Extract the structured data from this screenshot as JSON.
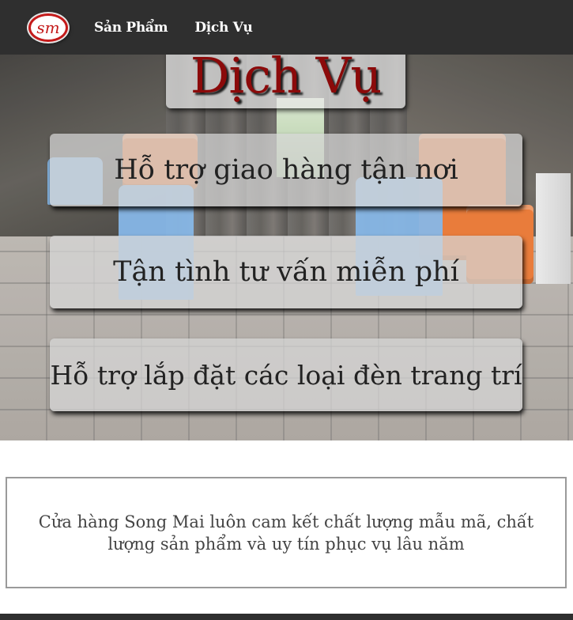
{
  "navbar": {
    "logo_text": "sm",
    "links": [
      {
        "label": "Sản Phẩm"
      },
      {
        "label": "Dịch Vụ"
      }
    ],
    "background": "#2f2f2f"
  },
  "hero": {
    "title": "Dịch Vụ",
    "title_color": "#8b0a0a",
    "services": [
      {
        "label": "Hỗ trợ giao hàng tận nơi"
      },
      {
        "label": "Tận tình tư vấn miễn phí"
      },
      {
        "label": "Hỗ trợ lắp đặt các loại đèn trang trí"
      }
    ]
  },
  "statement": {
    "text": "Cửa hàng Song Mai luôn cam kết chất lượng mẫu mã, chất lượng sản phẩm và uy tín phục vụ lâu năm"
  }
}
